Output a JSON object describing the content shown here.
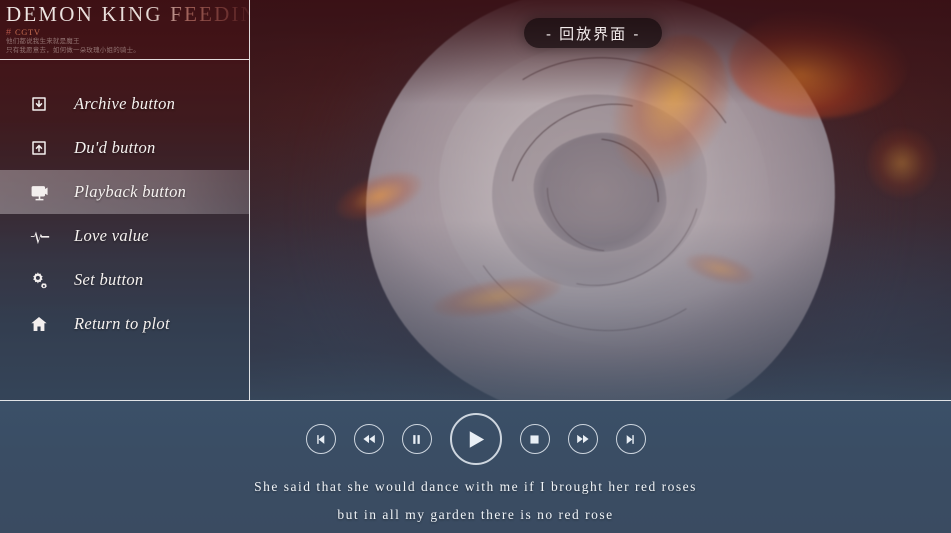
{
  "brand": {
    "title": "DEMON KING FEEDING",
    "hash_icon": "hash-icon",
    "channel": "CGTV",
    "subtitle_line1": "他们都说我生来就是魔王",
    "subtitle_line2": "只有我愿意去，如何做一朵玫瑰小姐的骑士。"
  },
  "sidebar": {
    "items": [
      {
        "label": "Archive button",
        "icon": "download-box-icon",
        "active": false
      },
      {
        "label": "Du'd button",
        "icon": "upload-box-icon",
        "active": false
      },
      {
        "label": "Playback button",
        "icon": "projector-icon",
        "active": true
      },
      {
        "label": "Love value",
        "icon": "pulse-icon",
        "active": false
      },
      {
        "label": "Set button",
        "icon": "gears-icon",
        "active": false
      },
      {
        "label": "Return to plot",
        "icon": "home-icon",
        "active": false
      }
    ]
  },
  "header": {
    "chip_label": "- 回放界面 -"
  },
  "transport": {
    "controls": [
      {
        "name": "skip-previous-button",
        "icon": "skip-previous-icon"
      },
      {
        "name": "rewind-button",
        "icon": "rewind-icon"
      },
      {
        "name": "pause-button",
        "icon": "pause-icon"
      },
      {
        "name": "play-button",
        "icon": "play-icon"
      },
      {
        "name": "stop-button",
        "icon": "stop-icon"
      },
      {
        "name": "fast-forward-button",
        "icon": "fast-forward-icon"
      },
      {
        "name": "skip-next-button",
        "icon": "skip-next-icon"
      }
    ],
    "subtitles": [
      "She said that she would dance with me if I brought her red roses",
      "but in all my garden there is no red rose"
    ]
  },
  "colors": {
    "accent_red": "#c06a4e",
    "sidebar_top": "#3e1014",
    "transport_bg": "#3a4d64",
    "border": "#ffffff",
    "text_light": "#f6f2f0"
  }
}
